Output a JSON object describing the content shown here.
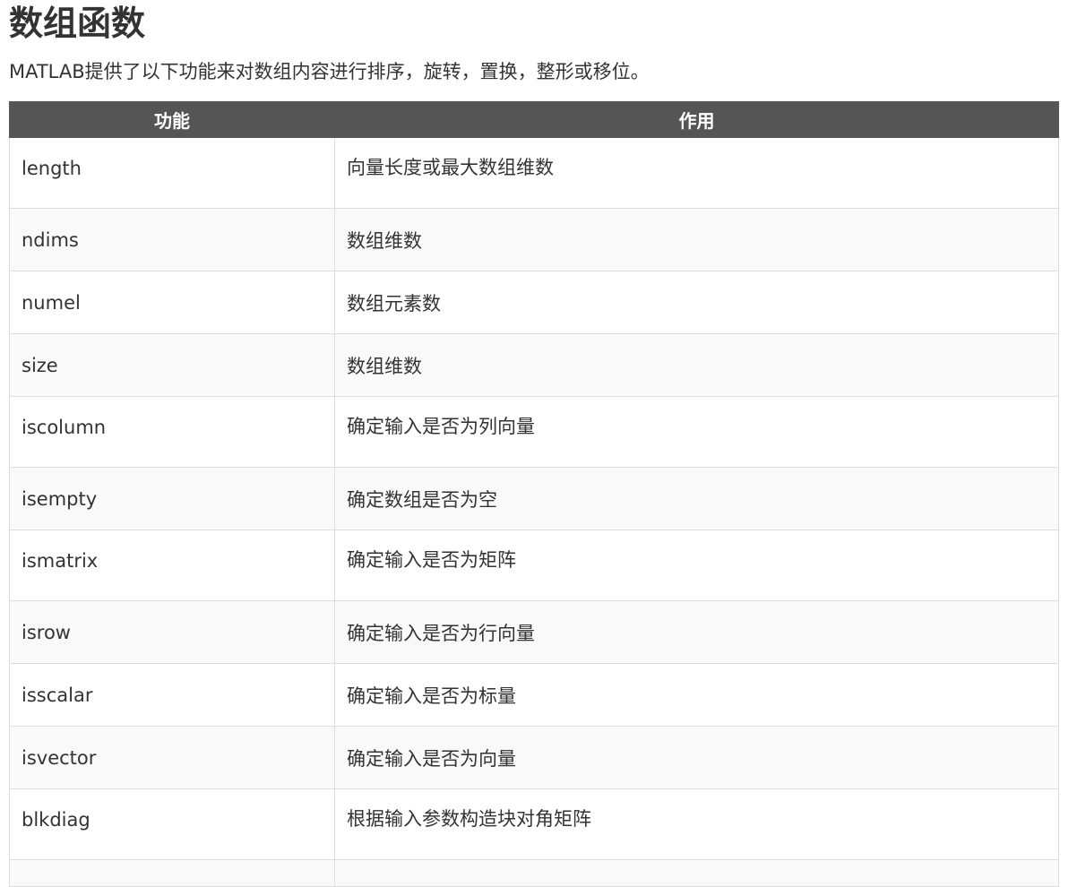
{
  "title": "数组函数",
  "intro": "MATLAB提供了以下功能来对数组内容进行排序，旋转，置换，整形或移位。",
  "table": {
    "headers": [
      "功能",
      "作用"
    ],
    "rows": [
      {
        "fn": "length",
        "desc": "向量长度或最大数组维数"
      },
      {
        "fn": "ndims",
        "desc": "数组维数"
      },
      {
        "fn": "numel",
        "desc": "数组元素数"
      },
      {
        "fn": "size",
        "desc": "数组维数"
      },
      {
        "fn": "iscolumn",
        "desc": "确定输入是否为列向量"
      },
      {
        "fn": "isempty",
        "desc": "确定数组是否为空"
      },
      {
        "fn": "ismatrix",
        "desc": "确定输入是否为矩阵"
      },
      {
        "fn": "isrow",
        "desc": "确定输入是否为行向量"
      },
      {
        "fn": "isscalar",
        "desc": "确定输入是否为标量"
      },
      {
        "fn": "isvector",
        "desc": "确定输入是否为向量"
      },
      {
        "fn": "blkdiag",
        "desc": "根据输入参数构造块对角矩阵"
      }
    ]
  }
}
